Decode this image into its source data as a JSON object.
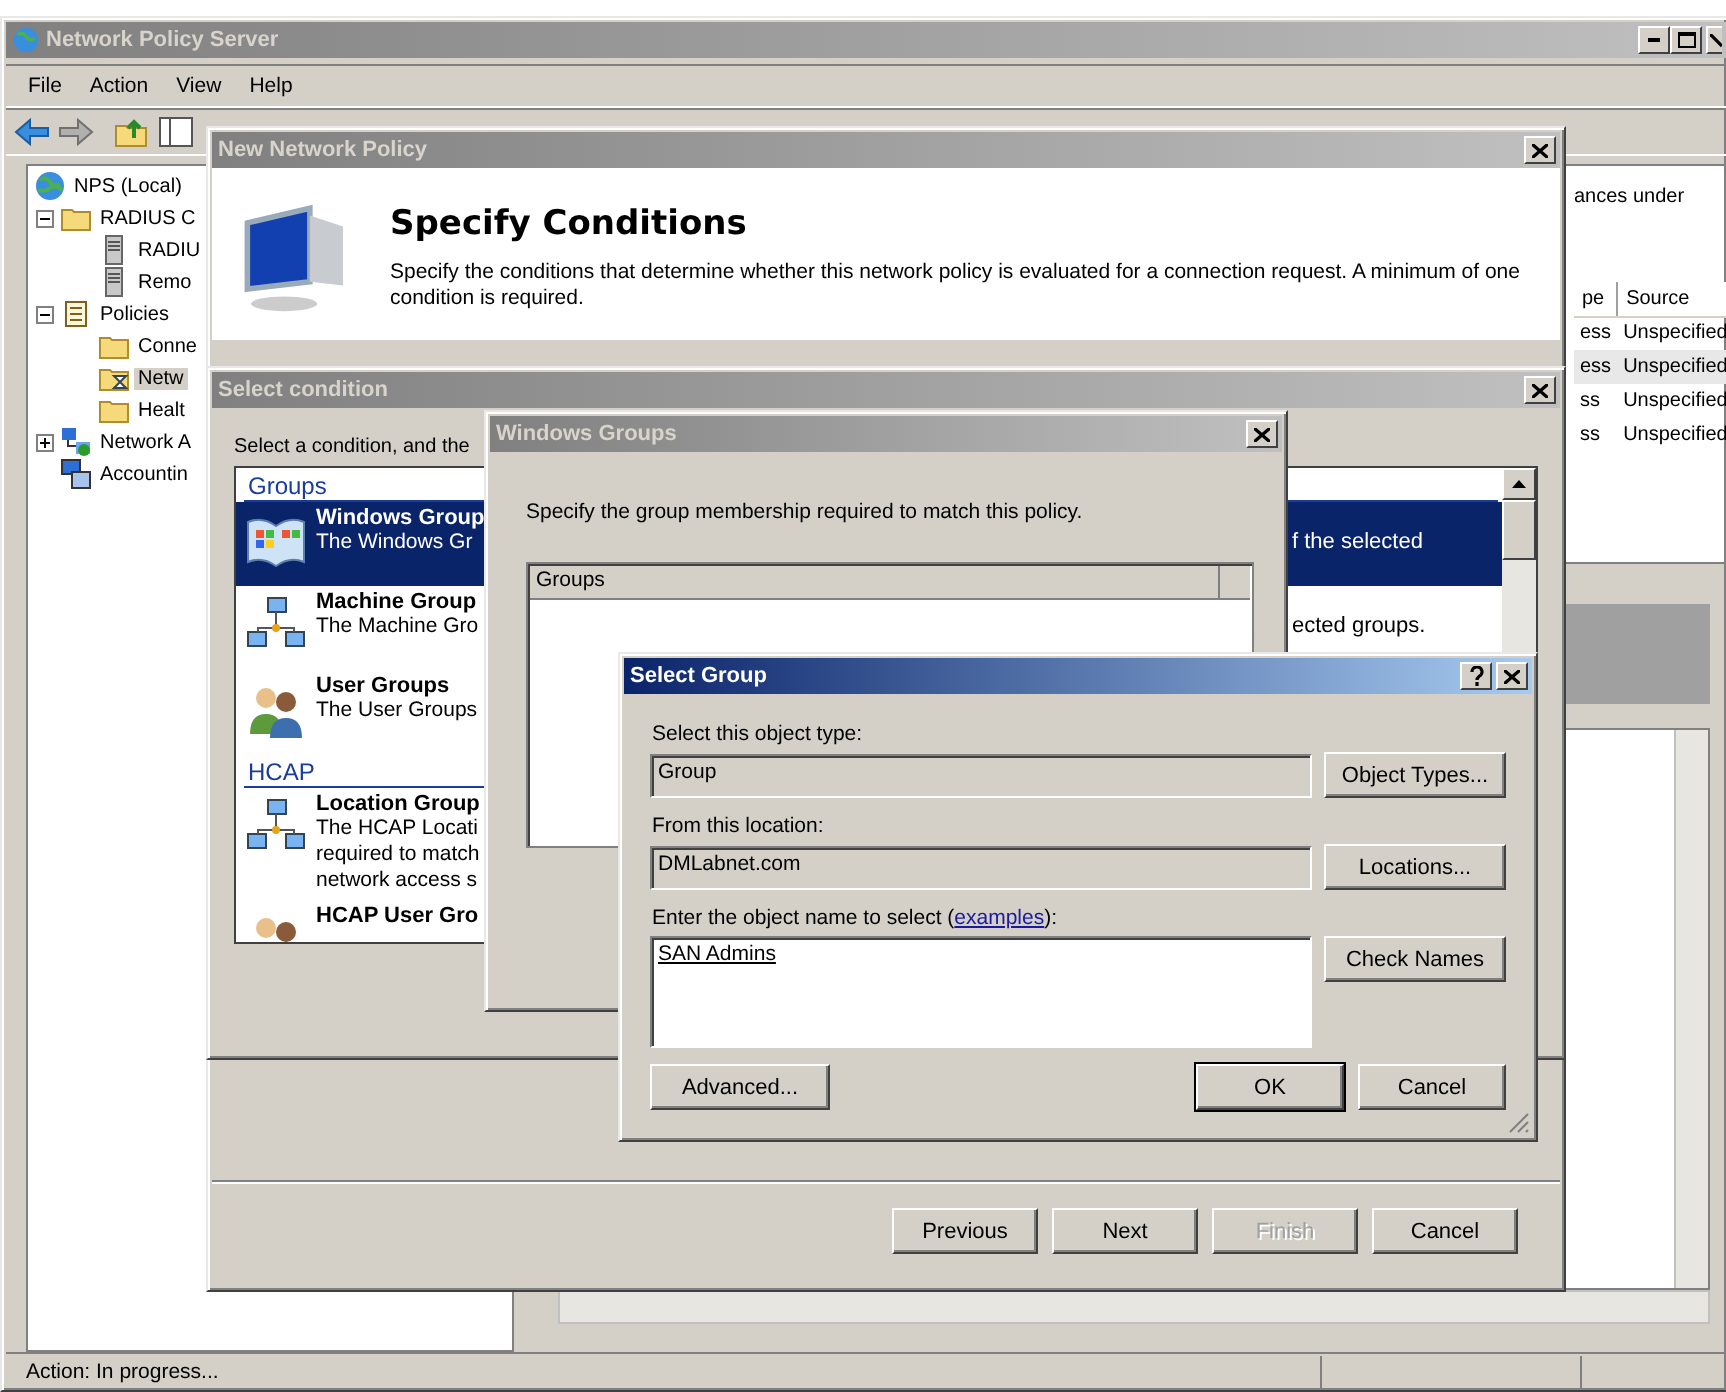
{
  "main_window": {
    "title": "Network Policy Server",
    "menu": [
      "File",
      "Action",
      "View",
      "Help"
    ],
    "tree": [
      {
        "label": "NPS (Local)",
        "kind": "globe",
        "selected": false,
        "children": [
          {
            "label": "RADIUS C",
            "kind": "folder",
            "expanded": true,
            "selected": false,
            "children": [
              {
                "label": "RADIU",
                "kind": "server",
                "selected": false
              },
              {
                "label": "Remo",
                "kind": "server",
                "selected": false
              }
            ]
          },
          {
            "label": "Policies",
            "kind": "scroll",
            "expanded": true,
            "selected": false,
            "children": [
              {
                "label": "Conne",
                "kind": "folder",
                "selected": false
              },
              {
                "label": "Netw",
                "kind": "busy",
                "selected": true
              },
              {
                "label": "Healt",
                "kind": "folder",
                "selected": false
              }
            ]
          },
          {
            "label": "Network A",
            "kind": "network",
            "expanded": false,
            "selected": false
          },
          {
            "label": "Accountin",
            "kind": "computer",
            "selected": false
          }
        ]
      }
    ],
    "pane_text": "ances under",
    "table": {
      "columns": [
        "pe",
        "Source"
      ],
      "rows": [
        {
          "cells": [
            "ess",
            "Unspecified"
          ],
          "selected": false
        },
        {
          "cells": [
            "ess",
            "Unspecified"
          ],
          "selected": true
        },
        {
          "cells": [
            "ss",
            "Unspecified"
          ],
          "selected": false
        },
        {
          "cells": [
            "ss",
            "Unspecified"
          ],
          "selected": false
        }
      ]
    },
    "status_bar": "Action:  In progress..."
  },
  "new_policy": {
    "title": "New Network Policy",
    "heading": "Specify Conditions",
    "description": "Specify the conditions that determine whether this network policy is evaluated for a connection request. A minimum of one condition is required.",
    "buttons": [
      {
        "label": "Previous",
        "disabled": false
      },
      {
        "label": "Next",
        "disabled": false
      },
      {
        "label": "Finish",
        "disabled": true
      },
      {
        "label": "Cancel",
        "disabled": false
      }
    ]
  },
  "select_condition": {
    "title": "Select condition",
    "instruction": "Select a condition, and the",
    "sections": [
      {
        "heading": "Groups",
        "items": [
          {
            "title": "Windows Group",
            "description": [
              "The Windows Gr"
            ],
            "tail": "f the selected",
            "kind": "windows",
            "selected": true
          },
          {
            "title": "Machine Group",
            "description": [
              "The Machine Gro"
            ],
            "tail": "ected groups.",
            "kind": "network",
            "selected": false
          },
          {
            "title": "User Groups",
            "description": [
              "The User Groups"
            ],
            "kind": "users",
            "selected": false
          }
        ]
      },
      {
        "heading": "HCAP",
        "items": [
          {
            "title": "Location Group",
            "description": [
              "The HCAP Locati",
              "required to match",
              "network access s"
            ],
            "kind": "network",
            "selected": false
          },
          {
            "title": "HCAP User Gro",
            "kind": "users",
            "selected": false
          }
        ]
      }
    ]
  },
  "windows_groups": {
    "title": "Windows Groups",
    "instruction": "Specify the group membership required to match this policy.",
    "list_header": "Groups"
  },
  "select_group": {
    "title": "Select Group",
    "type_label": "Select this object type:",
    "type_value": "Group",
    "type_button": "Object Types...",
    "location_label": "From this location:",
    "location_value": "DMLabnet.com",
    "location_button": "Locations...",
    "name_label_before": "Enter the object name to select (",
    "name_label_link": "examples",
    "name_label_after": "):",
    "name_value": "SAN Admins",
    "check_button": "Check Names",
    "advanced_button": "Advanced...",
    "ok_button": "OK",
    "cancel_button": "Cancel"
  }
}
